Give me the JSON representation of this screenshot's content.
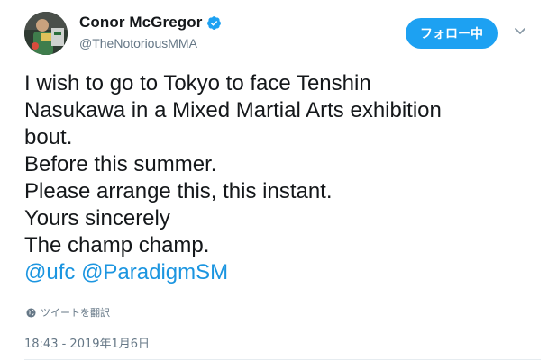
{
  "author": {
    "display_name": "Conor McGregor",
    "handle": "@TheNotoriousMMA",
    "verified": true,
    "avatar_icon": "avatar-photo"
  },
  "follow_button": {
    "label": "フォロー中"
  },
  "menu": {
    "icon": "chevron-down-icon"
  },
  "tweet": {
    "lines": [
      "I wish to go to Tokyo to face Tenshin",
      "Nasukawa in a Mixed Martial Arts exhibition",
      "bout.",
      "Before this summer.",
      "Please arrange this, this instant.",
      "Yours sincerely",
      "The champ champ."
    ],
    "mentions": [
      "@ufc",
      "@ParadigmSM"
    ]
  },
  "translate": {
    "label": "ツイートを翻訳",
    "icon": "globe-icon"
  },
  "timestamp": "18:43 - 2019年1月6日",
  "colors": {
    "accent": "#1da1f2",
    "link": "#1b95e0",
    "text": "#14171a",
    "muted": "#657786"
  }
}
